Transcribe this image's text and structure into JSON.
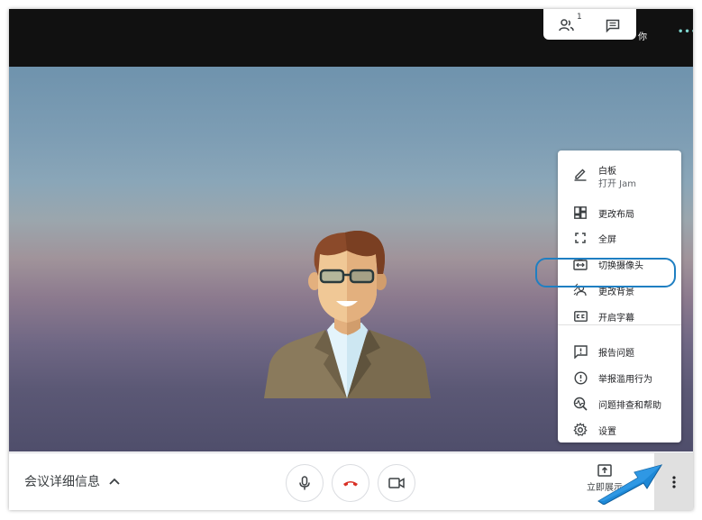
{
  "top": {
    "participants_count": "1",
    "you_label": "你",
    "more_dots": "•••"
  },
  "bottom": {
    "meeting_details": "会议详细信息",
    "present_label": "立即展示"
  },
  "menu": {
    "items": [
      {
        "label": "白板",
        "sub": "打开 Jam",
        "icon": "pen-icon"
      },
      {
        "label": "更改布局",
        "icon": "layout-icon"
      },
      {
        "label": "全屏",
        "icon": "fullscreen-icon"
      },
      {
        "label": "切换摄像头",
        "icon": "switch-camera-icon"
      },
      {
        "label": "更改背景",
        "icon": "background-icon"
      },
      {
        "label": "开启字幕",
        "icon": "captions-icon"
      },
      {
        "label": "报告问题",
        "icon": "report-icon"
      },
      {
        "label": "举报滥用行为",
        "icon": "abuse-icon"
      },
      {
        "label": "问题排查和帮助",
        "icon": "troubleshoot-icon"
      },
      {
        "label": "设置",
        "icon": "settings-icon"
      }
    ]
  },
  "colors": {
    "highlight": "#1f7fc2",
    "hangup": "#d93025",
    "arrow": "#1e88d6"
  }
}
